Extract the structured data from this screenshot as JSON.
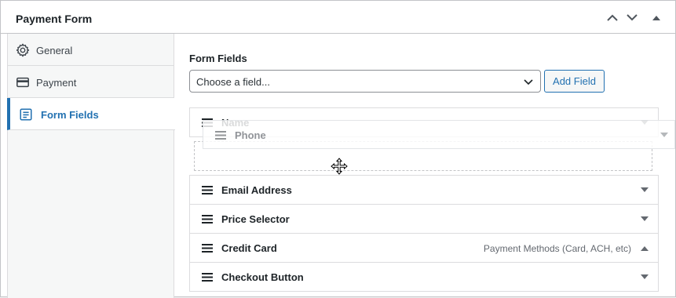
{
  "panel": {
    "title": "Payment Form",
    "controls": [
      "chevron-up-icon",
      "chevron-down-icon",
      "triangle-up-icon"
    ]
  },
  "sidebar": {
    "items": [
      {
        "label": "General",
        "icon": "gear-icon",
        "active": false
      },
      {
        "label": "Payment",
        "icon": "credit-card-icon",
        "active": false
      },
      {
        "label": "Form Fields",
        "icon": "form-list-icon",
        "active": true
      }
    ]
  },
  "main": {
    "section_label": "Form Fields",
    "select": {
      "value": "Choose a field..."
    },
    "add_button_label": "Add Field",
    "fields": [
      {
        "label": "Name",
        "meta": "",
        "toggle": "down"
      },
      {
        "label": "Email Address",
        "meta": "",
        "toggle": "down"
      },
      {
        "label": "Price Selector",
        "meta": "",
        "toggle": "down"
      },
      {
        "label": "Credit Card",
        "meta": "Payment Methods (Card, ACH, etc)",
        "toggle": "up"
      },
      {
        "label": "Checkout Button",
        "meta": "",
        "toggle": "down"
      }
    ],
    "dragging_field": {
      "label": "Phone"
    }
  },
  "colors": {
    "accent": "#2271b1",
    "border": "#c3c4c7",
    "sidebar_bg": "#f6f7f7"
  }
}
